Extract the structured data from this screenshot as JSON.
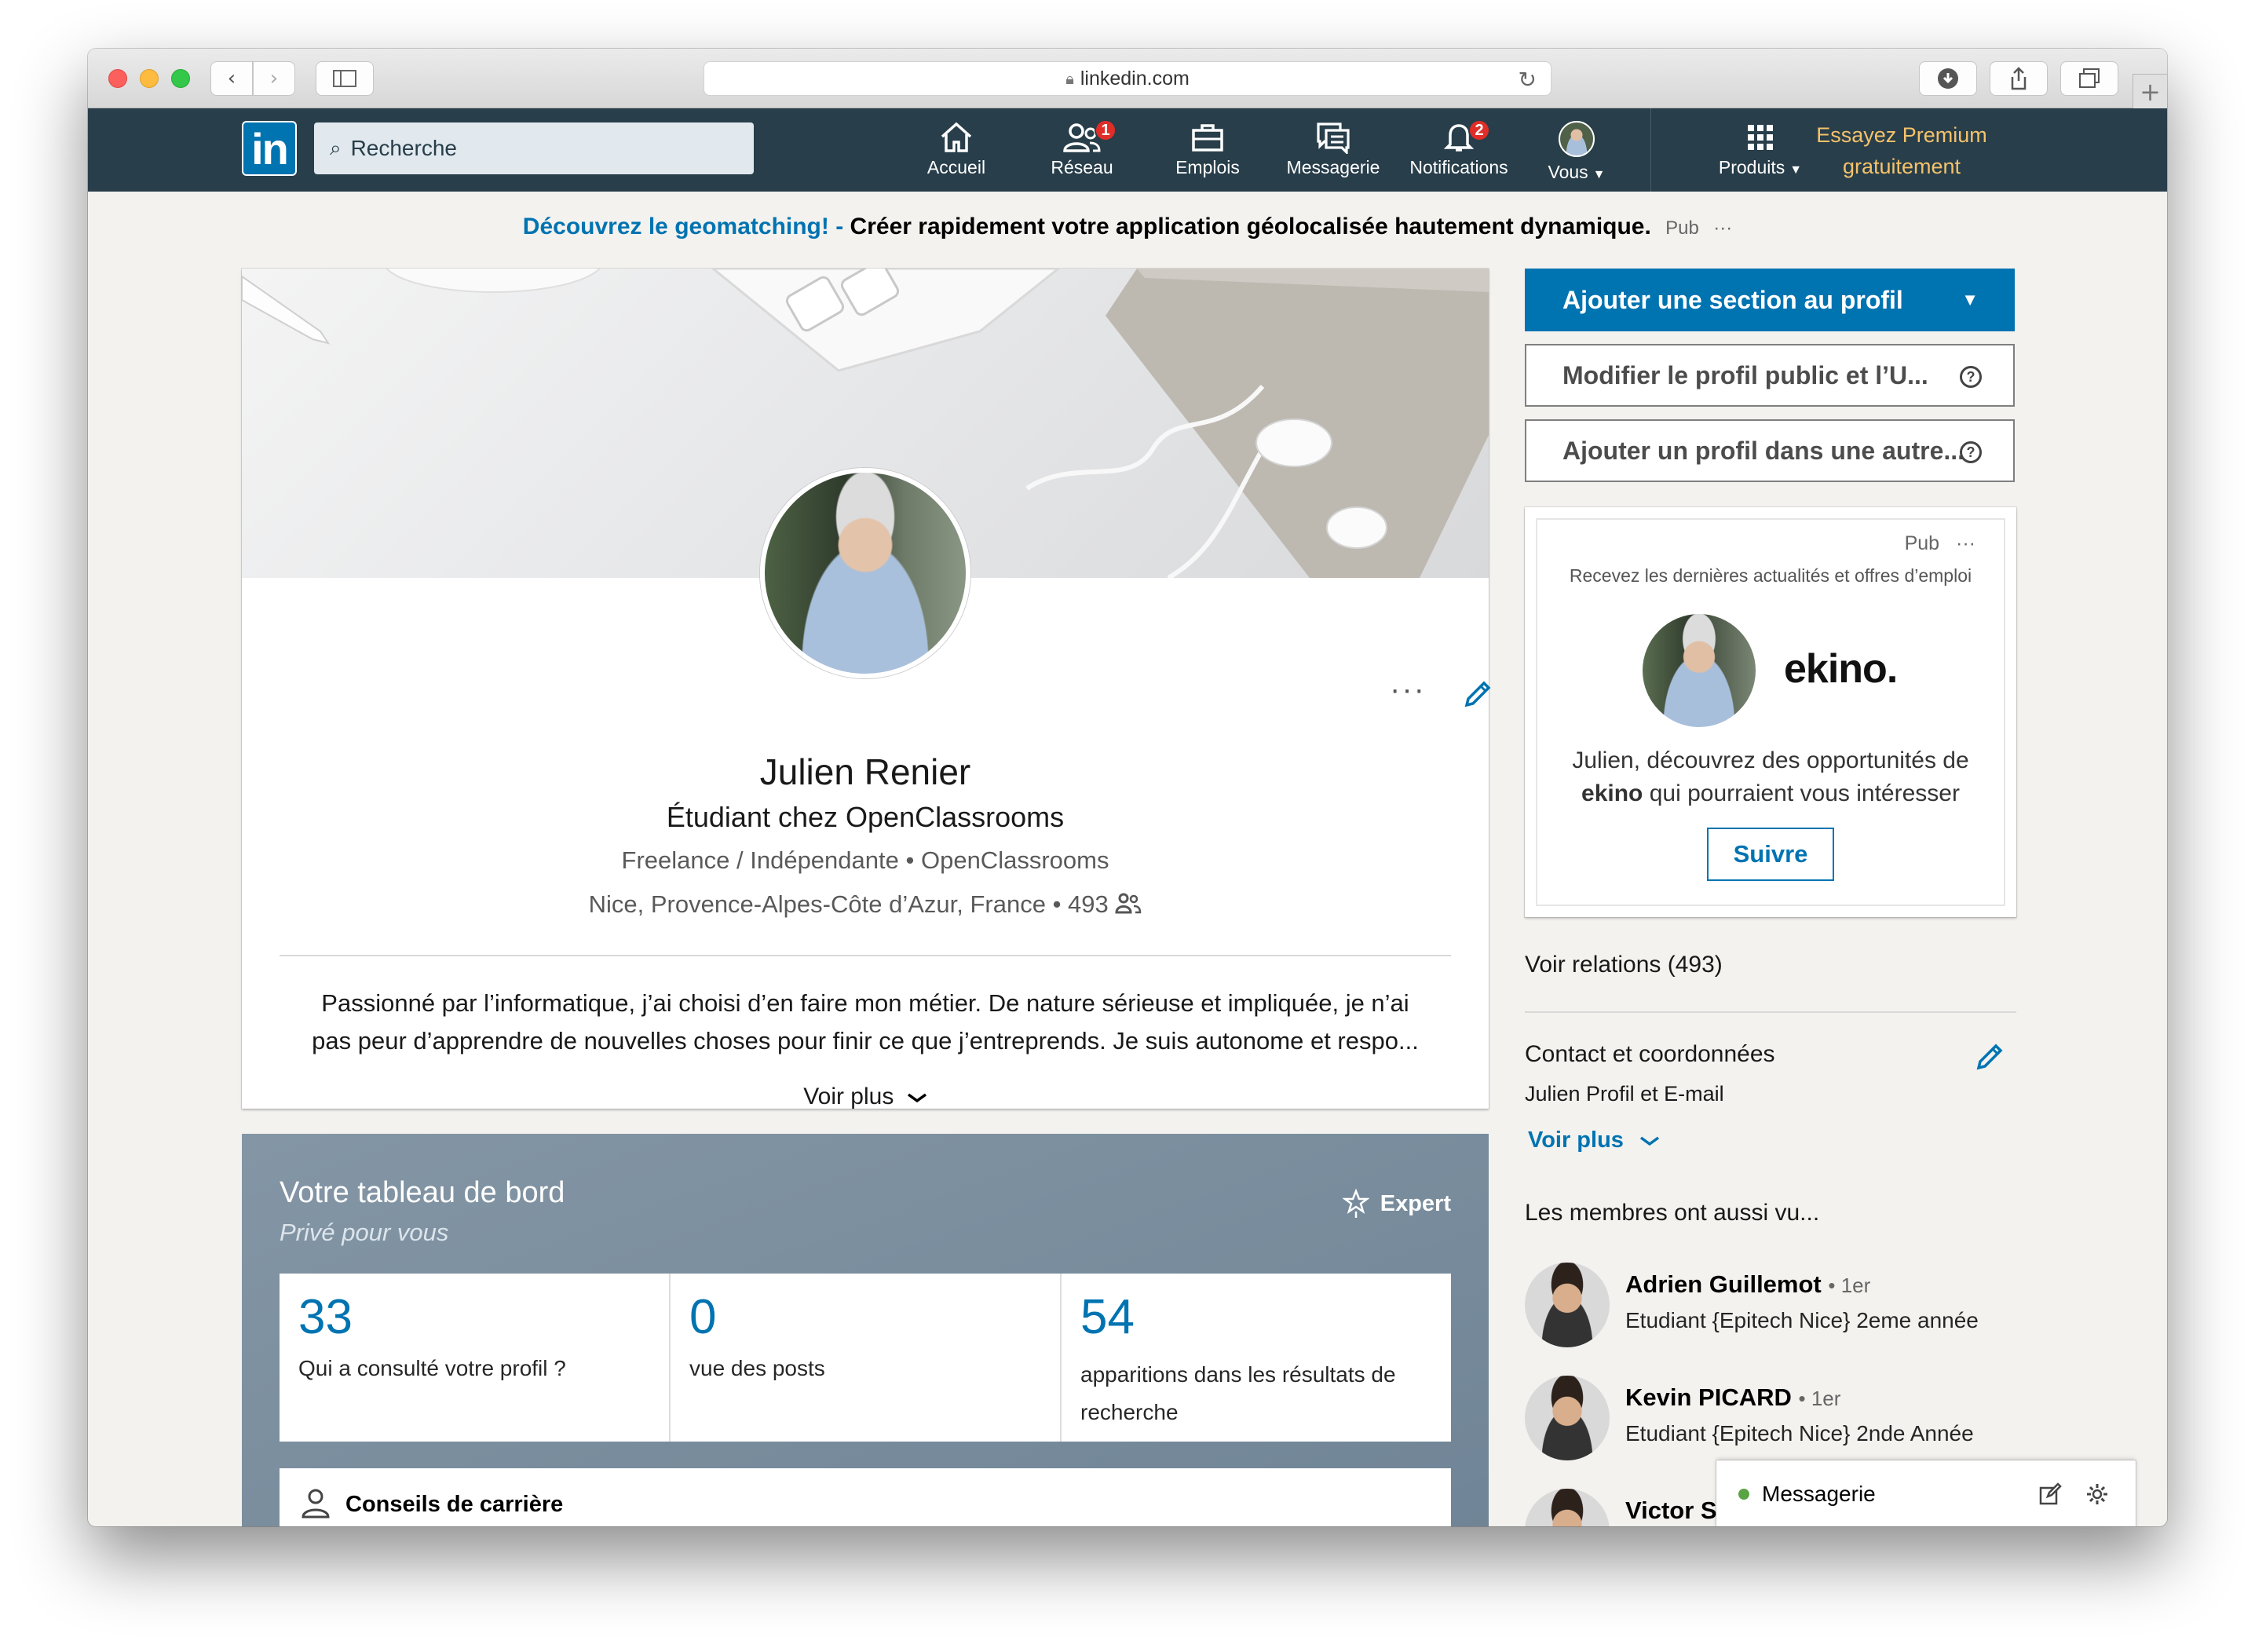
{
  "browser": {
    "url": "linkedin.com"
  },
  "nav": {
    "logo": "in",
    "search_placeholder": "Recherche",
    "items": [
      {
        "label": "Accueil",
        "icon": "home-icon"
      },
      {
        "label": "Réseau",
        "icon": "network-icon",
        "badge": "1"
      },
      {
        "label": "Emplois",
        "icon": "briefcase-icon"
      },
      {
        "label": "Messagerie",
        "icon": "messaging-icon"
      },
      {
        "label": "Notifications",
        "icon": "bell-icon",
        "badge": "2"
      },
      {
        "label": "Vous",
        "icon": "avatar"
      },
      {
        "label": "Produits",
        "icon": "grid-icon"
      }
    ],
    "premium_line1": "Essayez Premium",
    "premium_line2": "gratuitement"
  },
  "ad_banner": {
    "link": "Découvrez le geomatching! -",
    "text": "Créer rapidement votre application géolocalisée hautement dynamique.",
    "pub": "Pub",
    "more": "···"
  },
  "profile": {
    "name": "Julien Renier",
    "headline": "Étudiant chez OpenClassrooms",
    "company": "Freelance / Indépendante",
    "school": "OpenClassrooms",
    "location": "Nice, Provence-Alpes-Côte d’Azur, France",
    "connections": "493",
    "summary_line1": "Passionné par l’informatique, j’ai choisi d’en faire mon métier. De nature sérieuse et impliquée, je n’ai",
    "summary_line2": "pas peur d’apprendre de nouvelles choses pour finir ce que j’entreprends. Je suis autonome et respo...",
    "see_more": "Voir plus",
    "more_dots": "···"
  },
  "dashboard": {
    "title": "Votre tableau de bord",
    "subtitle": "Privé pour vous",
    "badge": "Expert",
    "stats": [
      {
        "value": "33",
        "label": "Qui a consulté votre profil ?"
      },
      {
        "value": "0",
        "label": "vue des posts"
      },
      {
        "value": "54",
        "label_line1": "apparitions dans les résultats de",
        "label_line2": "recherche"
      }
    ],
    "career_tips": "Conseils de carrière"
  },
  "sidebar": {
    "add_section": "Ajouter une section au profil",
    "edit_public": "Modifier le profil public et l’U...",
    "add_language": "Ajouter un profil dans une autre...",
    "ad": {
      "pub": "Pub",
      "more": "···",
      "tagline": "Recevez les dernières actualités et offres d’emploi",
      "brand": "ekino.",
      "line1": "Julien, découvrez des opportunités de",
      "brand_bold": "ekino",
      "line2_rest": "qui pourraient vous intéresser",
      "follow": "Suivre"
    },
    "relations": "Voir relations (493)",
    "contact_title": "Contact et coordonnées",
    "contact_sub": "Julien Profil et E-mail",
    "contact_more": "Voir plus",
    "also_viewed": "Les membres ont aussi vu...",
    "people": [
      {
        "name": "Adrien Guillemot",
        "degree": "• 1er",
        "title": "Etudiant {Epitech Nice} 2eme année"
      },
      {
        "name": "Kevin PICARD",
        "degree": "• 1er",
        "title": "Etudiant {Epitech Nice} 2nde Année"
      },
      {
        "name": "Victor S",
        "degree": "",
        "title": ""
      }
    ]
  },
  "messaging": {
    "label": "Messagerie"
  }
}
